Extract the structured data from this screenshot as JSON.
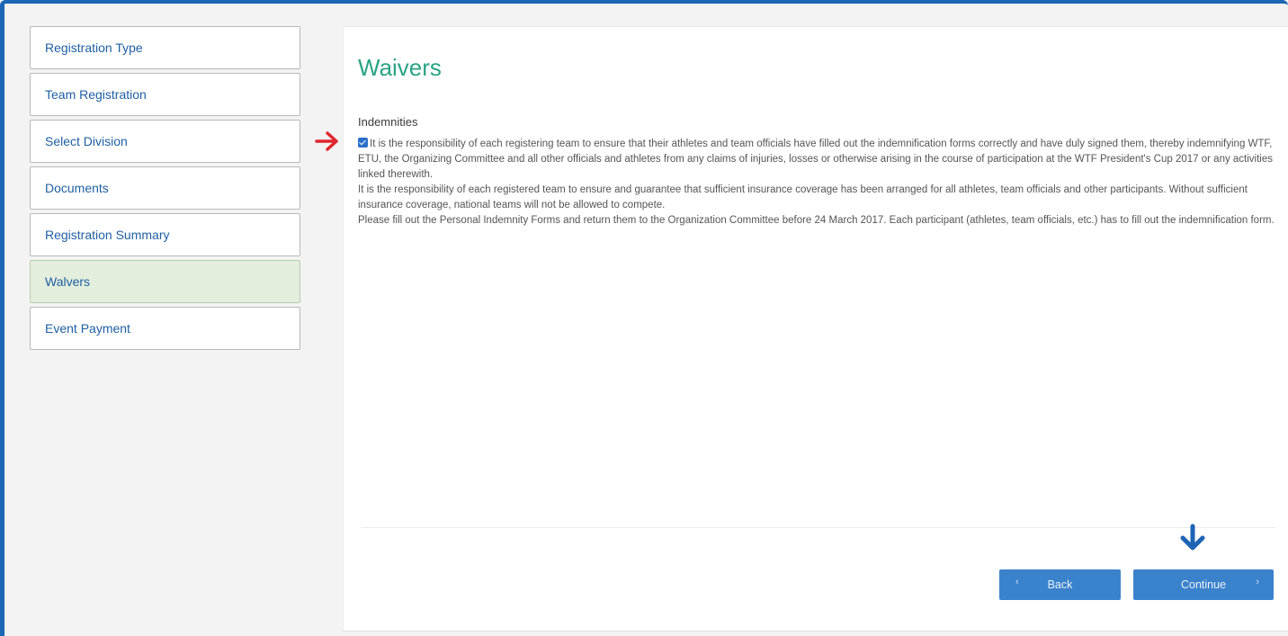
{
  "sidebar": {
    "items": [
      {
        "label": "Registration Type"
      },
      {
        "label": "Team Registration"
      },
      {
        "label": "Select Division"
      },
      {
        "label": "Documents"
      },
      {
        "label": "Registration Summary"
      },
      {
        "label": "Walvers",
        "active": true
      },
      {
        "label": "Event Payment"
      }
    ]
  },
  "main": {
    "title": "Waivers",
    "section_title": "Indemnities",
    "waiver": {
      "checked": true,
      "paragraph_1": "It is the responsibility of each registering team to ensure that their athletes and team officials have filled out the indemnification forms correctly and have duly signed them, thereby indemnifying WTF, ETU, the Organizing Committee and all other officials and athletes from any claims of injuries, losses or otherwise arising in the course of participation at the WTF President's Cup 2017 or any activities linked therewith.",
      "paragraph_2": "It is the responsibility of each registered team to ensure and guarantee that sufficient insurance coverage has been arranged for all athletes, team officials and other participants. Without sufficient insurance coverage, national teams will not be allowed to compete.",
      "paragraph_3": "Please fill out the Personal Indemnity Forms and return them to the Organization Committee before 24 March 2017. Each participant (athletes, team officials, etc.) has to fill out the indemnification form."
    },
    "buttons": {
      "back_label": "Back",
      "continue_label": "Continue"
    }
  },
  "icons": {
    "back": "chevron-left-icon",
    "continue": "chevron-right-icon",
    "annotation_checkbox": "red-arrow-right-icon",
    "annotation_continue": "blue-arrow-down-icon"
  },
  "colors": {
    "frame_border": "#1b66b5",
    "title": "#2aa386",
    "nav_text": "#1f5fa3",
    "active_step_bg": "#e3eedc",
    "button_bg": "#3b82cc",
    "red_arrow": "#e0262e",
    "blue_arrow": "#1f63b4"
  }
}
